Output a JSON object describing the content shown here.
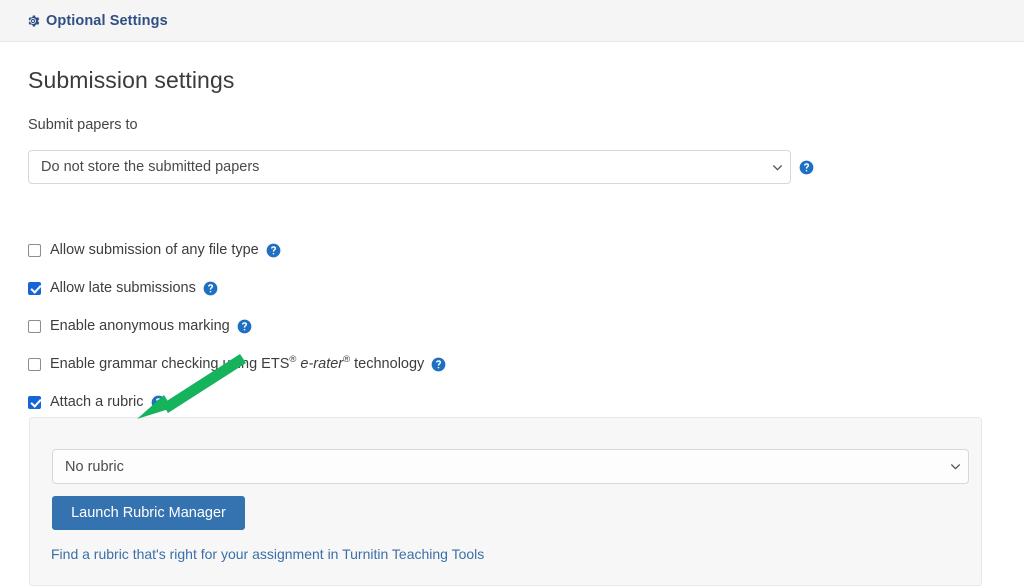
{
  "header": {
    "icon": "gear-icon",
    "title": "Optional Settings"
  },
  "main": {
    "page_title": "Submission settings",
    "submit_papers": {
      "label": "Submit papers to",
      "selected_value": "Do not store the submitted papers",
      "help_icon": "help-circle-icon",
      "chevron_icon": "chevron-down-icon"
    },
    "checkboxes": [
      {
        "name": "allow-any-file-type",
        "label": "Allow submission of any file type",
        "checked": false,
        "help_icon": "help-circle-icon"
      },
      {
        "name": "allow-late-submissions",
        "label": "Allow late submissions",
        "checked": true,
        "help_icon": "help-circle-icon"
      },
      {
        "name": "enable-anonymous-marking",
        "label": "Enable anonymous marking",
        "checked": false,
        "help_icon": "help-circle-icon"
      },
      {
        "name": "enable-grammar-checking",
        "label": "Enable grammar checking using ETS® e-rater® technology",
        "label_parts": {
          "before": "Enable grammar checking using ETS",
          "sup1": "®",
          "brand": "e-rater",
          "sup2": "®",
          "after": " technology"
        },
        "checked": false,
        "help_icon": "help-circle-icon"
      },
      {
        "name": "attach-a-rubric",
        "label": "Attach a rubric",
        "checked": true,
        "help_icon": "help-circle-icon"
      }
    ],
    "rubric_panel": {
      "select_value": "No rubric",
      "chevron_icon": "chevron-down-icon",
      "launch_button": "Launch Rubric Manager",
      "link_text": "Find a rubric that's right for your assignment in Turnitin Teaching Tools"
    }
  },
  "annotation": {
    "name": "green-arrow",
    "color": "#15b35c",
    "points_at": "No rubric"
  },
  "colors": {
    "header_bg": "#f5f5f5",
    "header_text": "#2f4f82",
    "accent_blue": "#1565d8",
    "button_blue": "#3572b0",
    "link_blue": "#3b6fa8",
    "help_blue": "#1f70c1",
    "panel_bg": "#f7f7f7",
    "arrow_green": "#15b35c"
  }
}
